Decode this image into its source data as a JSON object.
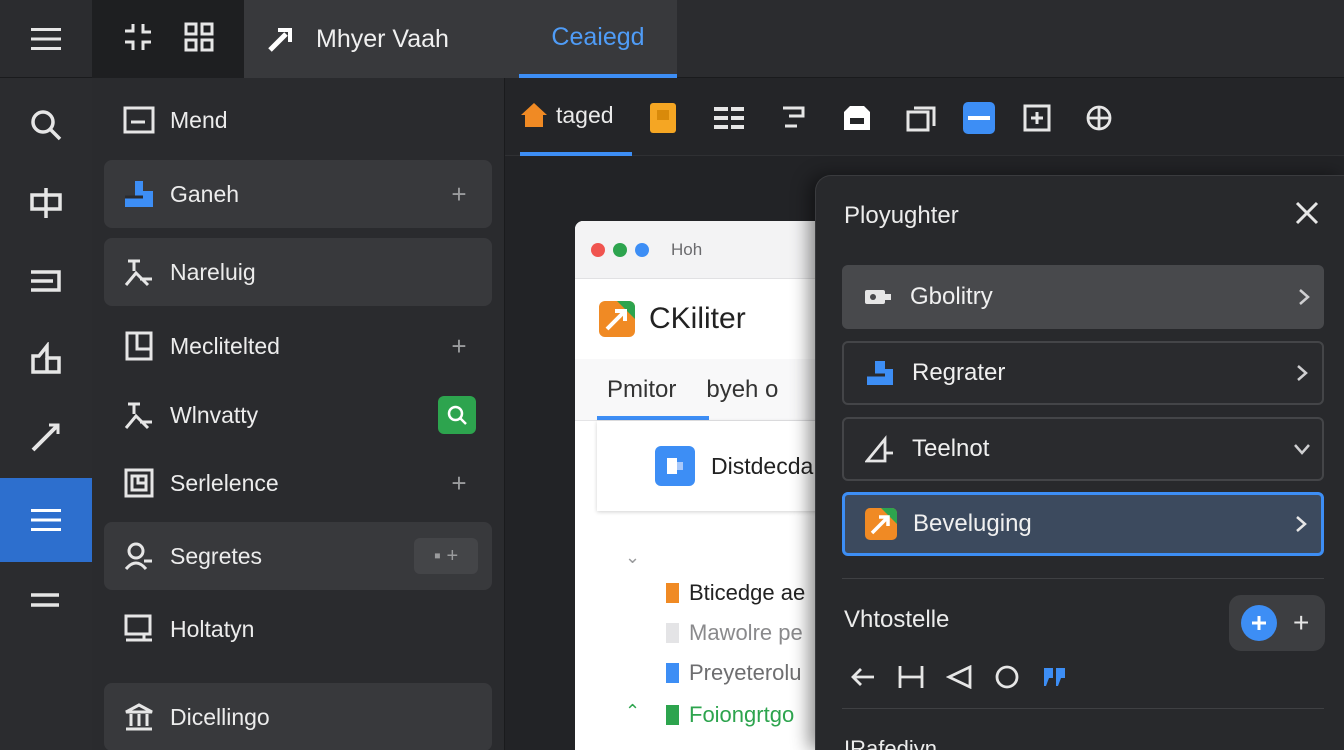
{
  "topbar": {
    "title": "Mhyer Vaah",
    "active_tab": "Ceaiegd"
  },
  "panel": {
    "items": [
      {
        "label": "Mend",
        "style": "plain",
        "icon": "window-icon"
      },
      {
        "label": "Ganeh",
        "style": "card",
        "icon": "stack-icon",
        "action": "+"
      },
      {
        "label": "Nareluig",
        "style": "card",
        "icon": "person-icon"
      },
      {
        "label": "Meclitelted",
        "style": "plain",
        "icon": "page-icon",
        "action": "+"
      },
      {
        "label": "Wlnvatty",
        "style": "plain",
        "icon": "person-icon"
      },
      {
        "label": "Serlelence",
        "style": "plain",
        "icon": "doc-icon",
        "action": "+"
      },
      {
        "label": "Segretes",
        "style": "card",
        "icon": "user-icon"
      },
      {
        "label": "Holtatyn",
        "style": "plain",
        "icon": "monitor-icon"
      },
      {
        "label": "Dicellingo",
        "style": "card",
        "icon": "bank-icon"
      }
    ],
    "plus_label": "+",
    "pill_label": "▪ +"
  },
  "toolbar": {
    "tab_label": "taged"
  },
  "doc": {
    "window_title": "Hoh",
    "brand": "CKiliter",
    "tabs": [
      "Pmitor",
      "byeh o"
    ],
    "card_label": "Distdecda",
    "rows": [
      {
        "text": "Bticedge ae",
        "color": "#f08a24",
        "text_color": "#222222"
      },
      {
        "text": "Mawolre pe",
        "color": "#e4e4e6",
        "text_color": "#8a8a8c"
      },
      {
        "text": "Preyeterolu",
        "color": "#3d8ef5",
        "text_color": "#6e6e70"
      },
      {
        "text": "Foiongrtgo",
        "color": "#2da44e",
        "text_color": "#2da44e"
      }
    ]
  },
  "rpanel": {
    "title": "Ployughter",
    "items": [
      {
        "label": "Gbolitry",
        "style": "filled",
        "chevron": "right"
      },
      {
        "label": "Regrater",
        "style": "outlined",
        "chevron": "right"
      },
      {
        "label": "Teelnot",
        "style": "outlined",
        "chevron": "down"
      },
      {
        "label": "Beveluging",
        "style": "selected",
        "chevron": "right"
      }
    ],
    "section_title": "Vhtostelle",
    "add_plus": "+",
    "bottom_title": "IRafediyn"
  },
  "colors": {
    "accent": "#3d8ef5",
    "green": "#2da44e",
    "orange": "#f08a24"
  }
}
